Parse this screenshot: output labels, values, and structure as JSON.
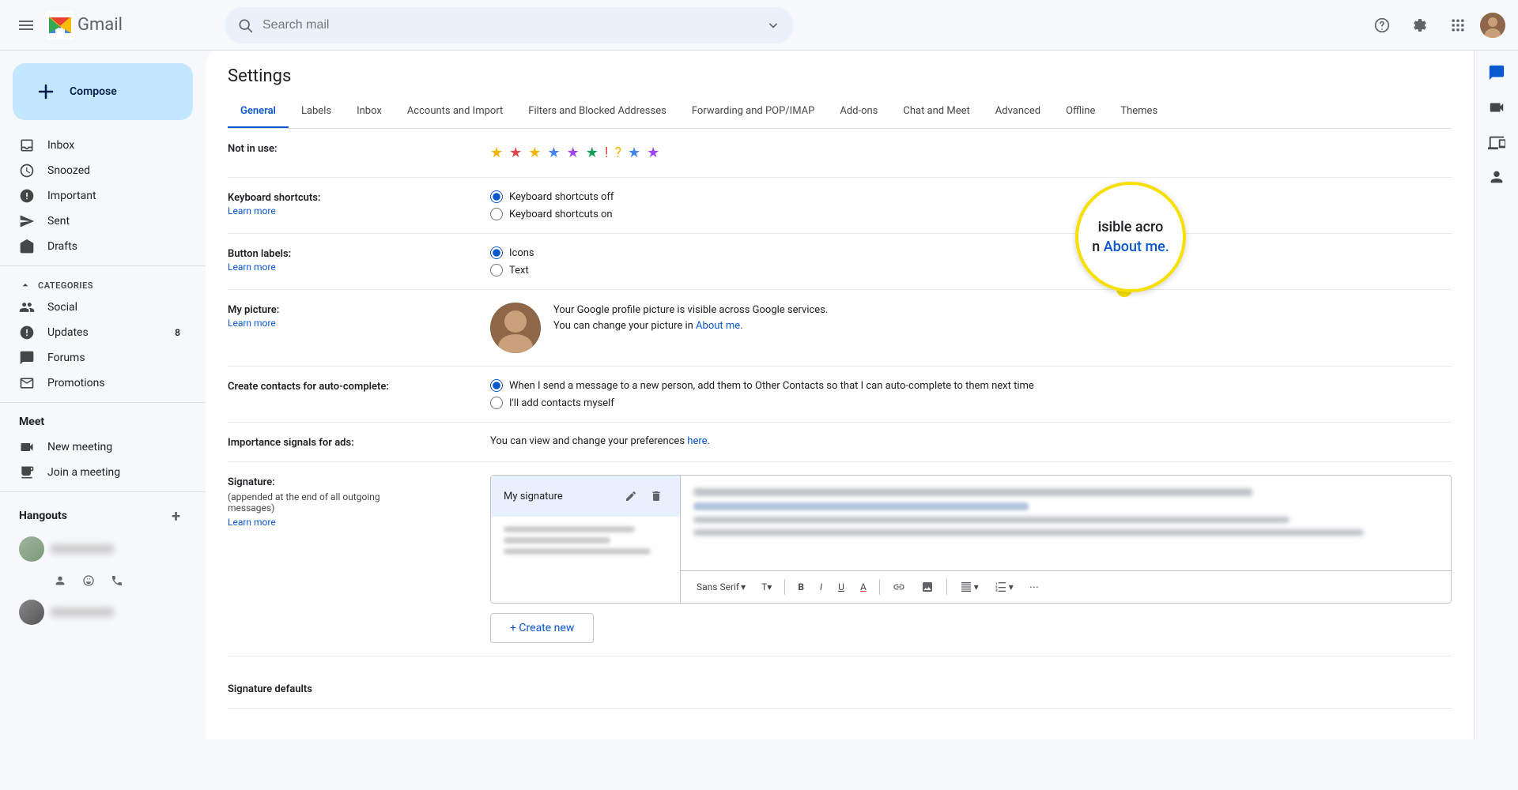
{
  "topbar": {
    "search_placeholder": "Search mail",
    "gmail_label": "Gmail"
  },
  "sidebar": {
    "compose_label": "Compose",
    "items": [
      {
        "id": "inbox",
        "label": "Inbox",
        "icon": "inbox",
        "badge": ""
      },
      {
        "id": "snoozed",
        "label": "Snoozed",
        "icon": "snooze",
        "badge": ""
      },
      {
        "id": "important",
        "label": "Important",
        "icon": "label-important",
        "badge": ""
      },
      {
        "id": "sent",
        "label": "Sent",
        "icon": "send",
        "badge": ""
      },
      {
        "id": "drafts",
        "label": "Drafts",
        "icon": "drafts",
        "badge": ""
      }
    ],
    "categories_label": "Categories",
    "categories": [
      {
        "id": "social",
        "label": "Social",
        "icon": "people"
      },
      {
        "id": "updates",
        "label": "Updates",
        "icon": "info",
        "badge": "8"
      },
      {
        "id": "forums",
        "label": "Forums",
        "icon": "forum"
      },
      {
        "id": "promotions",
        "label": "Promotions",
        "icon": "label"
      }
    ],
    "meet_label": "Meet",
    "meet_items": [
      {
        "id": "new-meeting",
        "label": "New meeting",
        "icon": "videocam"
      },
      {
        "id": "join-meeting",
        "label": "Join a meeting",
        "icon": "keyboard"
      }
    ],
    "hangouts_label": "Hangouts",
    "hangouts_add_label": "+"
  },
  "settings": {
    "title": "Settings",
    "tabs": [
      {
        "id": "general",
        "label": "General",
        "active": true
      },
      {
        "id": "labels",
        "label": "Labels"
      },
      {
        "id": "inbox",
        "label": "Inbox"
      },
      {
        "id": "accounts",
        "label": "Accounts and Import"
      },
      {
        "id": "filters",
        "label": "Filters and Blocked Addresses"
      },
      {
        "id": "forwarding",
        "label": "Forwarding and POP/IMAP"
      },
      {
        "id": "addons",
        "label": "Add-ons"
      },
      {
        "id": "chat",
        "label": "Chat and Meet"
      },
      {
        "id": "advanced",
        "label": "Advanced"
      },
      {
        "id": "offline",
        "label": "Offline"
      },
      {
        "id": "themes",
        "label": "Themes"
      }
    ],
    "rows": {
      "not_in_use": "Not in use:",
      "keyboard_shortcuts": {
        "label": "Keyboard shortcuts:",
        "learn_more": "Learn more",
        "options": [
          {
            "id": "off",
            "label": "Keyboard shortcuts off",
            "checked": true
          },
          {
            "id": "on",
            "label": "Keyboard shortcuts on",
            "checked": false
          }
        ]
      },
      "button_labels": {
        "label": "Button labels:",
        "learn_more": "Learn more",
        "options": [
          {
            "id": "icons",
            "label": "Icons",
            "checked": true
          },
          {
            "id": "text",
            "label": "Text",
            "checked": false
          }
        ]
      },
      "my_picture": {
        "label": "My picture:",
        "learn_more": "Learn more",
        "desc1": "Your Google profile picture is visible across Google services.",
        "desc2": "You can change your picture in",
        "about_me": "About me",
        "period": "."
      },
      "auto_complete": {
        "label": "Create contacts for auto-complete:",
        "options": [
          {
            "id": "auto",
            "label": "When I send a message to a new person, add them to Other Contacts so that I can auto-complete to them next time",
            "checked": true
          },
          {
            "id": "manual",
            "label": "I'll add contacts myself",
            "checked": false
          }
        ]
      },
      "importance_signals": {
        "label": "Importance signals for ads:",
        "text": "You can view and change your preferences",
        "link": "here",
        "period": "."
      },
      "signature": {
        "label": "Signature:",
        "sublabel": "(appended at the end of all outgoing\nmessages)",
        "learn_more": "Learn more",
        "sig_name": "My signature",
        "toolbar": {
          "font": "Sans Serif",
          "size_icon": "▾",
          "bold": "B",
          "italic": "I",
          "underline": "U",
          "text_color": "A",
          "link": "🔗",
          "image": "🖼",
          "align": "≡",
          "list": "☰",
          "more": "⋯"
        },
        "create_new": "+ Create new"
      },
      "signature_defaults": {
        "label": "Signature defaults"
      }
    }
  },
  "zoom_overlay": {
    "line1": "isible acro",
    "line2": "n About me."
  },
  "right_panel": {
    "icons": [
      "chat",
      "meet",
      "spaces",
      "directory"
    ]
  }
}
